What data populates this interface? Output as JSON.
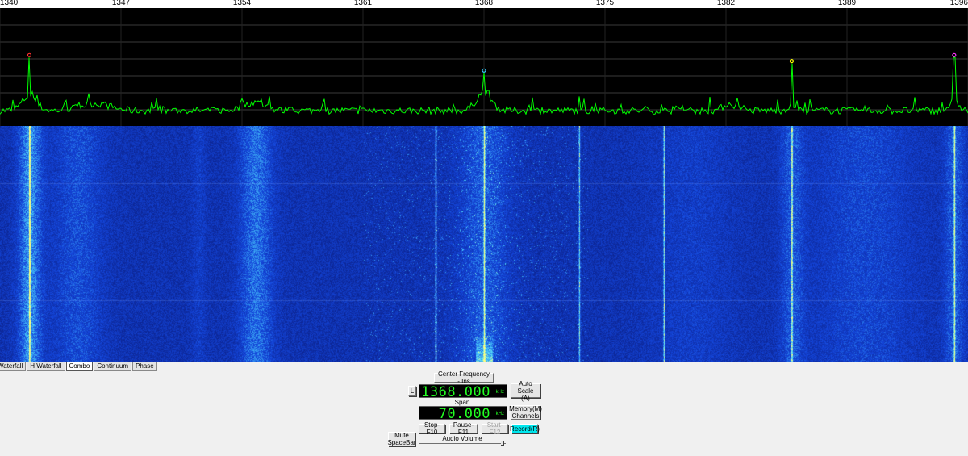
{
  "freq_axis": {
    "ticks": [
      "1340",
      "1347",
      "1354",
      "1361",
      "1368",
      "1375",
      "1382",
      "1389",
      "1396"
    ],
    "min_khz": 1340,
    "max_khz": 1396
  },
  "spectrum": {
    "trace_color": "#00ff00",
    "background": "#000000",
    "markers": [
      {
        "khz": 1341.7,
        "level": 0.58,
        "color": "#ff3030"
      },
      {
        "khz": 1368.0,
        "level": 0.45,
        "color": "#33ccff"
      },
      {
        "khz": 1385.8,
        "level": 0.53,
        "color": "#ffff00"
      },
      {
        "khz": 1395.2,
        "level": 0.58,
        "color": "#ff33ff"
      }
    ]
  },
  "waterfall": {
    "signal_lines_khz": [
      1341.7,
      1365.2,
      1368.0,
      1373.5,
      1378.4,
      1385.8,
      1395.2
    ],
    "colors": {
      "dark": "#0a1f8f",
      "mid": "#1a4fe0",
      "bright": "#6ef0ff",
      "peak": "#ffff80"
    }
  },
  "tabs": [
    "Waterfall",
    "H Waterfall",
    "Combo",
    "Continuum",
    "Phase"
  ],
  "active_tab": "Combo",
  "controls": {
    "center_freq_label": "Center Frequency - Ins",
    "l_button": "L",
    "center_value": "1368.000",
    "center_unit": "kHz",
    "auto_scale_line1": "Auto Scale",
    "auto_scale_line2": "(A)",
    "span_label": "Span",
    "span_value": "70.000",
    "span_unit": "kHz",
    "memory_line1": "Memory(M)",
    "memory_line2": "Channels",
    "stop_label": "Stop-F10",
    "pause_label": "Pause-F11",
    "start_label": "Start-F12",
    "record_label": "Record(R)",
    "mute_line1": "Mute",
    "mute_line2": "SpaceBar",
    "audio_volume_label": "Audio Volume",
    "audio_volume_level": 0.97
  }
}
